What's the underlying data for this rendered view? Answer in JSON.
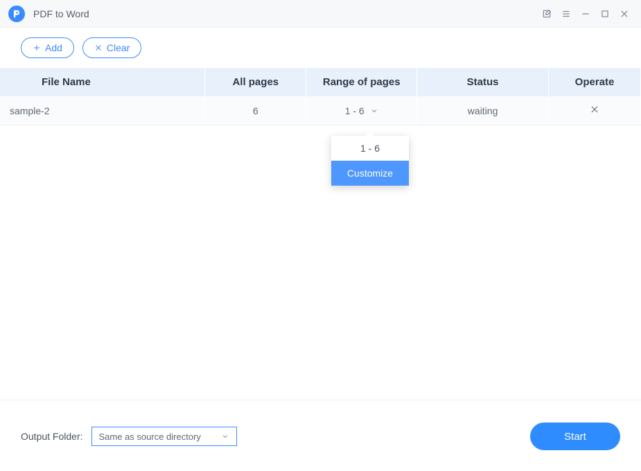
{
  "header": {
    "title": "PDF to Word"
  },
  "toolbar": {
    "add_label": "Add",
    "clear_label": "Clear"
  },
  "table": {
    "headers": {
      "file_name": "File Name",
      "all_pages": "All pages",
      "range": "Range of pages",
      "status": "Status",
      "operate": "Operate"
    },
    "rows": [
      {
        "file_name": "sample-2",
        "all_pages": "6",
        "range": "1 - 6",
        "status": "waiting"
      }
    ]
  },
  "dropdown": {
    "option_range": "1 - 6",
    "option_customize": "Customize"
  },
  "footer": {
    "folder_label": "Output Folder:",
    "folder_value": "Same as source directory",
    "start_label": "Start"
  }
}
